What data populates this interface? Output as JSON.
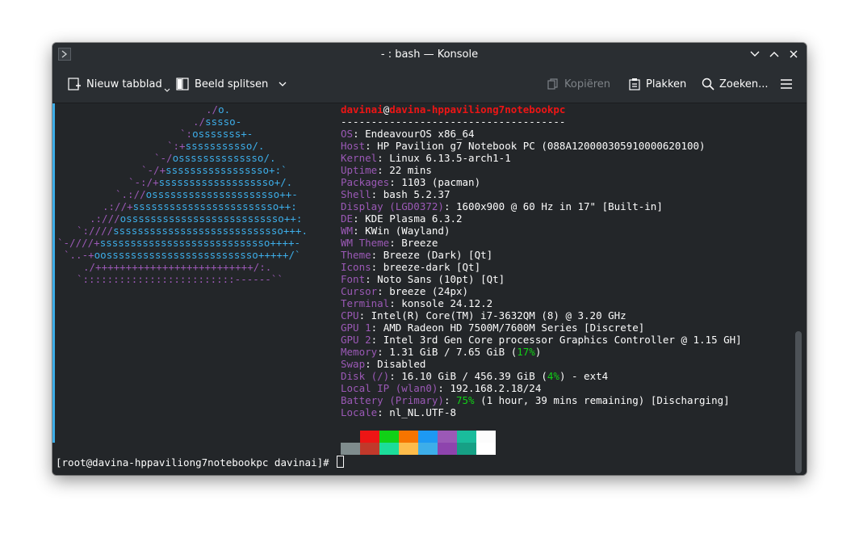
{
  "window": {
    "title": "- : bash — Konsole"
  },
  "toolbar": {
    "new_tab": "Nieuw tabblad",
    "split_view": "Beeld splitsen",
    "copy": "Kopiëren",
    "paste": "Plakken",
    "find": "Zoeken..."
  },
  "logo": {
    "lines": [
      {
        "a": "",
        "b": "./o."
      },
      {
        "a": "",
        "b": "./sssso-"
      },
      {
        "a": "",
        "b": "`:osssssss+-"
      },
      {
        "a": "",
        "b": "`:+sssssssssso/."
      },
      {
        "a": "",
        "b": "`-/ossssssssssssso/."
      },
      {
        "a": "",
        "b": "`-/+sssssssssssssssso+:`"
      },
      {
        "a": "",
        "b": "`-:/+sssssssssssssssssso+/."
      },
      {
        "a": "",
        "b": "`.://osssssssssssssssssssso++-"
      },
      {
        "a": "",
        "b": ".://+ssssssssssssssssssssssso++:"
      },
      {
        "a": "",
        "b": ".:///ossssssssssssssssssssssssso++:"
      },
      {
        "a": "",
        "b": "`:////ssssssssssssssssssssssssssso+++."
      },
      {
        "a": "",
        "b": "`-////+ssssssssssssssssssssssssssso++++-"
      },
      {
        "a": "",
        "b": "`..-+oosssssssssssssssssssssssso+++++/`"
      },
      {
        "a": "",
        "b": "./++++++++++++++++++++++++++/:."
      },
      {
        "a": "",
        "b": "`:::::::::::::::::::::::::------``"
      }
    ],
    "indents": [
      186,
      170,
      154,
      138,
      122,
      106,
      90,
      74,
      58,
      42,
      26,
      2,
      10,
      34,
      26
    ]
  },
  "info": {
    "user": "davinai",
    "at": "@",
    "host": "davina-hppaviliong7notebookpc",
    "separator": "-------------------------------------",
    "rows": [
      {
        "key": "OS",
        "value": ": EndeavourOS x86_64"
      },
      {
        "key": "Host",
        "value": ": HP Pavilion g7 Notebook PC (088A120000305910000620100)"
      },
      {
        "key": "Kernel",
        "value": ": Linux 6.13.5-arch1-1"
      },
      {
        "key": "Uptime",
        "value": ": 22 mins"
      },
      {
        "key": "Packages",
        "value": ": 1103 (pacman)"
      },
      {
        "key": "Shell",
        "value": ": bash 5.2.37"
      },
      {
        "key": "Display (LGD0372)",
        "value": ": 1600x900 @ 60 Hz in 17\" [Built-in]"
      },
      {
        "key": "DE",
        "value": ": KDE Plasma 6.3.2"
      },
      {
        "key": "WM",
        "value": ": KWin (Wayland)"
      },
      {
        "key": "WM Theme",
        "value": ": Breeze"
      },
      {
        "key": "Theme",
        "value": ": Breeze (Dark) [Qt]"
      },
      {
        "key": "Icons",
        "value": ": breeze-dark [Qt]"
      },
      {
        "key": "Font",
        "value": ": Noto Sans (10pt) [Qt]"
      },
      {
        "key": "Cursor",
        "value": ": breeze (24px)"
      },
      {
        "key": "Terminal",
        "value": ": konsole 24.12.2"
      },
      {
        "key": "CPU",
        "value": ": Intel(R) Core(TM) i7-3632QM (8) @ 3.20 GHz"
      },
      {
        "key": "GPU 1",
        "value": ": AMD Radeon HD 7500M/7600M Series [Discrete]"
      },
      {
        "key": "GPU 2",
        "value": ": Intel 3rd Gen Core processor Graphics Controller @ 1.15 GH]"
      }
    ],
    "memory": {
      "key": "Memory",
      "pre": ": 1.31 GiB / 7.65 GiB (",
      "pct": "17%",
      "post": ")"
    },
    "swap": {
      "key": "Swap",
      "value": ": Disabled"
    },
    "disk": {
      "key": "Disk (/)",
      "pre": ": 16.10 GiB / 456.39 GiB (",
      "pct": "4%",
      "post": ") - ext4"
    },
    "local_ip": {
      "key": "Local IP (wlan0)",
      "value": ": 192.168.2.18/24"
    },
    "battery": {
      "key": "Battery (Primary)",
      "pre": ": ",
      "pct": "75%",
      "post": " (1 hour, 39 mins remaining) [Discharging]"
    },
    "locale": {
      "key": "Locale",
      "value": ": nl_NL.UTF-8"
    }
  },
  "palette": {
    "top": [
      "#232629",
      "#ed1515",
      "#11d116",
      "#f67400",
      "#1d99f3",
      "#9b59b6",
      "#1abc9c",
      "#fcfcfc"
    ],
    "bottom": [
      "#7f8c8d",
      "#c0392b",
      "#1cdc9a",
      "#fdbc4b",
      "#3daee9",
      "#8e44ad",
      "#16a085",
      "#ffffff"
    ]
  },
  "prompt": {
    "text": "[root@davina-hppaviliong7notebookpc davinai]# "
  },
  "colors": {
    "accent": "#3daee9",
    "keys": "#9b59b6",
    "username": "#ed1515",
    "logo": "#3daee9",
    "logo_accent": "#9b59b6"
  }
}
